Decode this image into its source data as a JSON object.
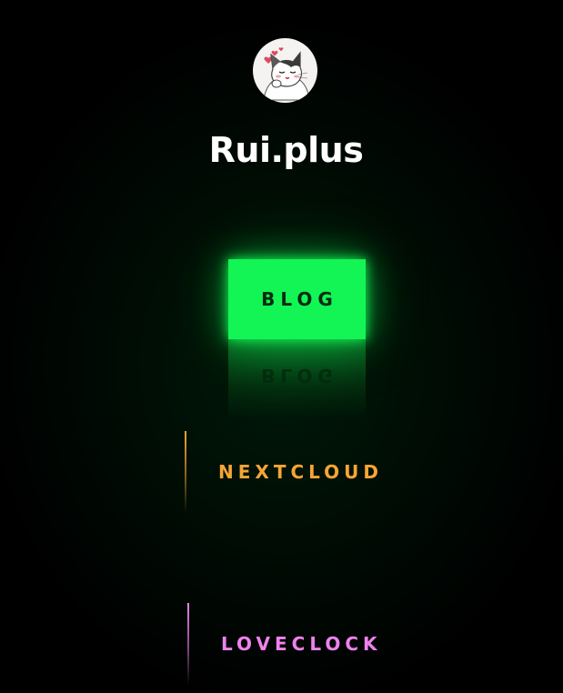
{
  "header": {
    "avatar_icon": "cat-avatar-icon",
    "site_title": "Rui.plus"
  },
  "links": [
    {
      "label": "BLOG",
      "state": "active",
      "color": "#13f554"
    },
    {
      "label": "NEXTCLOUD",
      "state": "normal",
      "color": "#f5a535"
    },
    {
      "label": "LOVECLOCK",
      "state": "normal",
      "color": "#ee82ee"
    }
  ],
  "colors": {
    "background": "#000000",
    "title": "#ffffff",
    "blog_text": "#062a10"
  }
}
